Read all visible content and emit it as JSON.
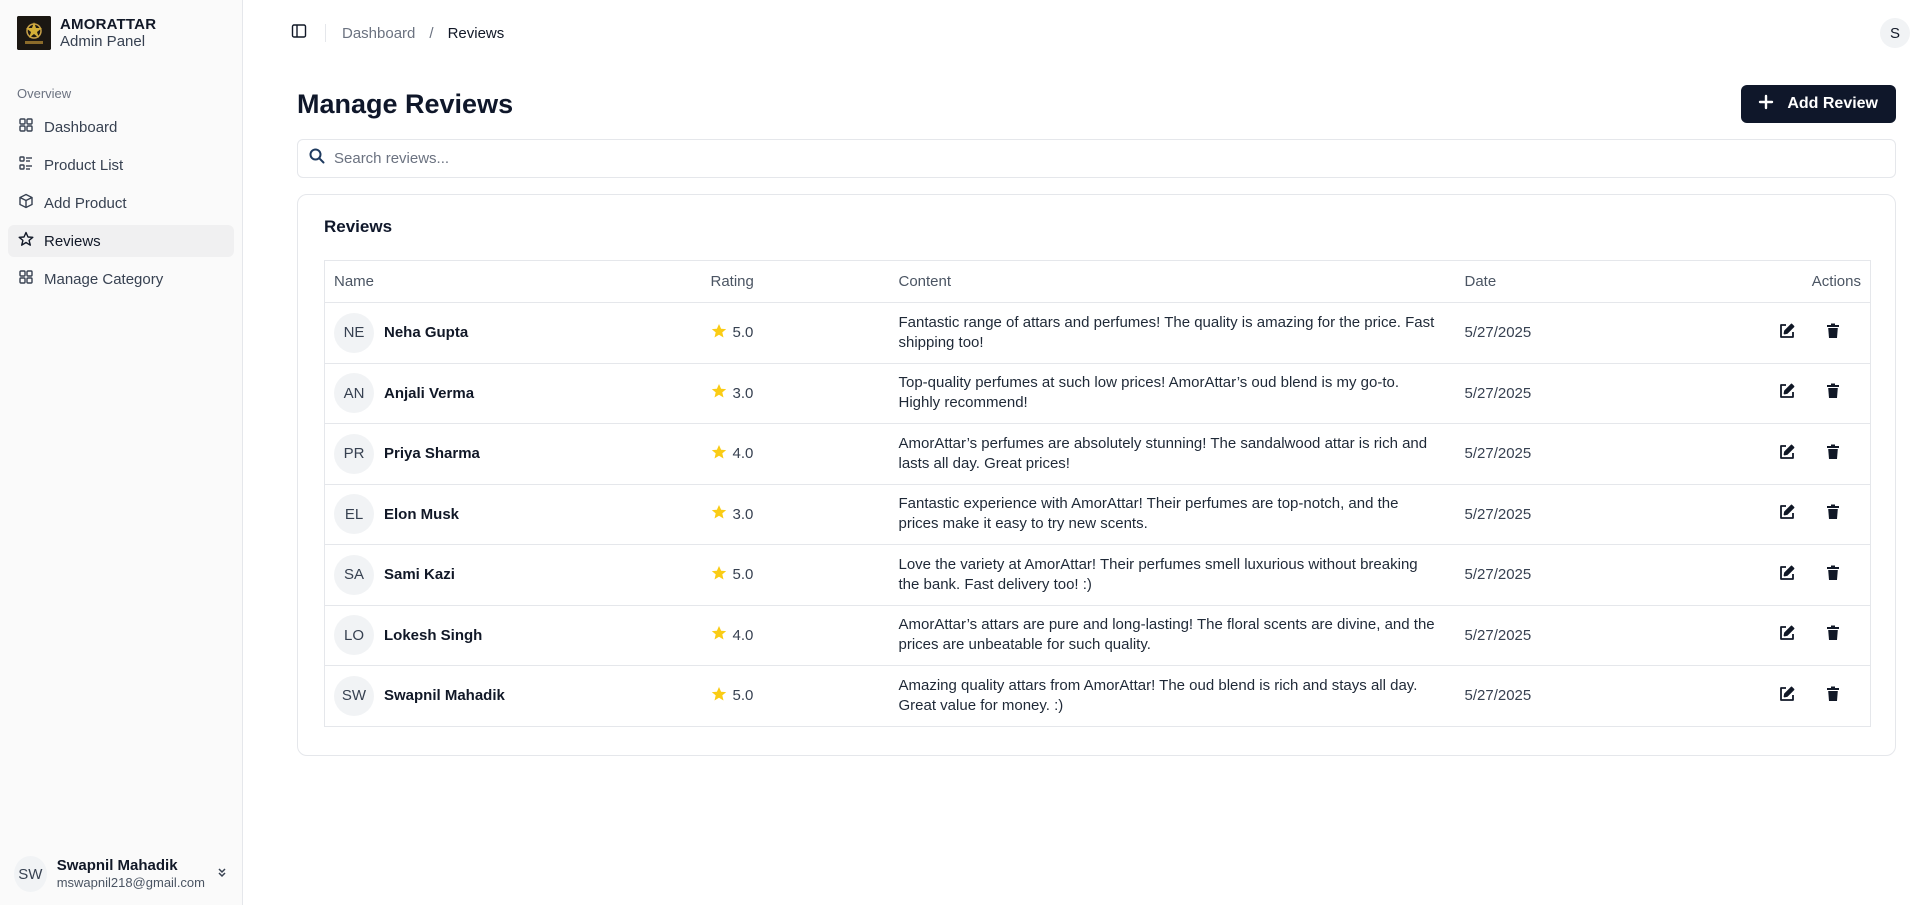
{
  "brand": {
    "name": "AMORATTAR",
    "subtitle": "Admin Panel"
  },
  "sidebar": {
    "section_label": "Overview",
    "items": [
      {
        "label": "Dashboard",
        "icon": "grid-icon",
        "active": false
      },
      {
        "label": "Product List",
        "icon": "list-icon",
        "active": false
      },
      {
        "label": "Add Product",
        "icon": "package-icon",
        "active": false
      },
      {
        "label": "Reviews",
        "icon": "star-icon",
        "active": true
      },
      {
        "label": "Manage Category",
        "icon": "grid-icon",
        "active": false
      }
    ],
    "user": {
      "initials": "SW",
      "name": "Swapnil Mahadik",
      "email": "mswapnil218@gmail.com"
    }
  },
  "topbar": {
    "breadcrumb": {
      "parent": "Dashboard",
      "separator": "/",
      "current": "Reviews"
    },
    "avatar_initial": "S"
  },
  "page": {
    "title": "Manage Reviews",
    "add_button_label": "Add Review",
    "search_placeholder": "Search reviews..."
  },
  "reviews_card": {
    "title": "Reviews",
    "columns": {
      "name": "Name",
      "rating": "Rating",
      "content": "Content",
      "date": "Date",
      "actions": "Actions"
    },
    "rows": [
      {
        "initials": "NE",
        "name": "Neha Gupta",
        "rating": "5.0",
        "content": "Fantastic range of attars and perfumes! The quality is amazing for the price. Fast shipping too!",
        "date": "5/27/2025"
      },
      {
        "initials": "AN",
        "name": "Anjali Verma",
        "rating": "3.0",
        "content": "Top-quality perfumes at such low prices! AmorAttar’s oud blend is my go-to. Highly recommend!",
        "date": "5/27/2025"
      },
      {
        "initials": "PR",
        "name": "Priya Sharma",
        "rating": "4.0",
        "content": "AmorAttar’s perfumes are absolutely stunning! The sandalwood attar is rich and lasts all day. Great prices!",
        "date": "5/27/2025"
      },
      {
        "initials": "EL",
        "name": "Elon Musk",
        "rating": "3.0",
        "content": "Fantastic experience with AmorAttar! Their perfumes are top-notch, and the prices make it easy to try new scents.",
        "date": "5/27/2025"
      },
      {
        "initials": "SA",
        "name": "Sami Kazi",
        "rating": "5.0",
        "content": "Love the variety at AmorAttar! Their perfumes smell luxurious without breaking the bank. Fast delivery too! :)",
        "date": "5/27/2025"
      },
      {
        "initials": "LO",
        "name": "Lokesh Singh",
        "rating": "4.0",
        "content": "AmorAttar’s attars are pure and long-lasting! The floral scents are divine, and the prices are unbeatable for such quality.",
        "date": "5/27/2025"
      },
      {
        "initials": "SW",
        "name": "Swapnil Mahadik",
        "rating": "5.0",
        "content": "Amazing quality attars from AmorAttar! The oud blend is rich and stays all day. Great value for money. :)",
        "date": "5/27/2025"
      }
    ]
  },
  "colors": {
    "primary": "#0f172a",
    "star": "#facc15",
    "border": "#e5e7eb",
    "sidebar_bg": "#fafafa"
  }
}
